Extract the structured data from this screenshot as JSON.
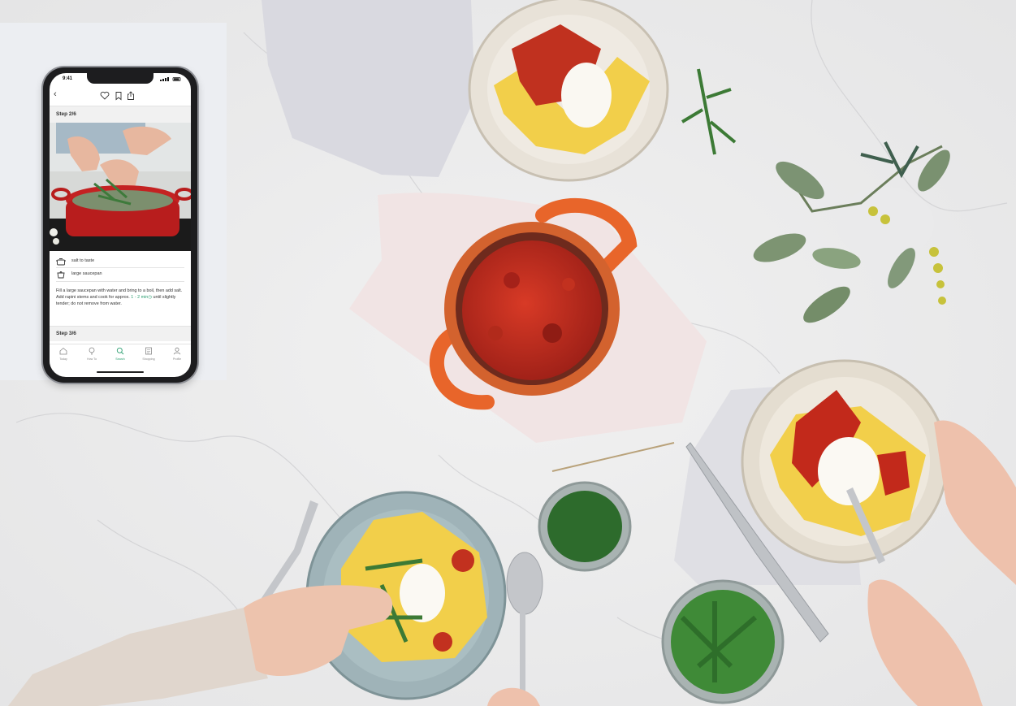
{
  "phone": {
    "status": {
      "time": "9:41"
    },
    "current_step": {
      "label": "Step 2/6"
    },
    "utensils": [
      {
        "icon": "pot-icon",
        "label": "salt to taste"
      },
      {
        "icon": "saucepan-icon",
        "label": "large saucepan"
      }
    ],
    "instruction": {
      "text_before": "Fill a large saucepan with water and bring to a boil, then add salt. Add rapini stems and cook for approx.",
      "timer": "1 - 2 min",
      "text_after": "until slightly tender; do not remove from water."
    },
    "next_step": {
      "label": "Step 3/6"
    },
    "tabs": [
      {
        "icon": "home-icon",
        "label": "Today"
      },
      {
        "icon": "lightbulb-icon",
        "label": "How To"
      },
      {
        "icon": "search-icon",
        "label": "Search",
        "active": true
      },
      {
        "icon": "shopping-list-icon",
        "label": "Shopping"
      },
      {
        "icon": "profile-icon",
        "label": "Profile"
      }
    ]
  },
  "colors": {
    "accent": "#2a9d6f",
    "marble": "#ececec",
    "pot_orange": "#e8652a",
    "sauce_red": "#b8261c",
    "pasta_yellow": "#f2cf4a"
  }
}
